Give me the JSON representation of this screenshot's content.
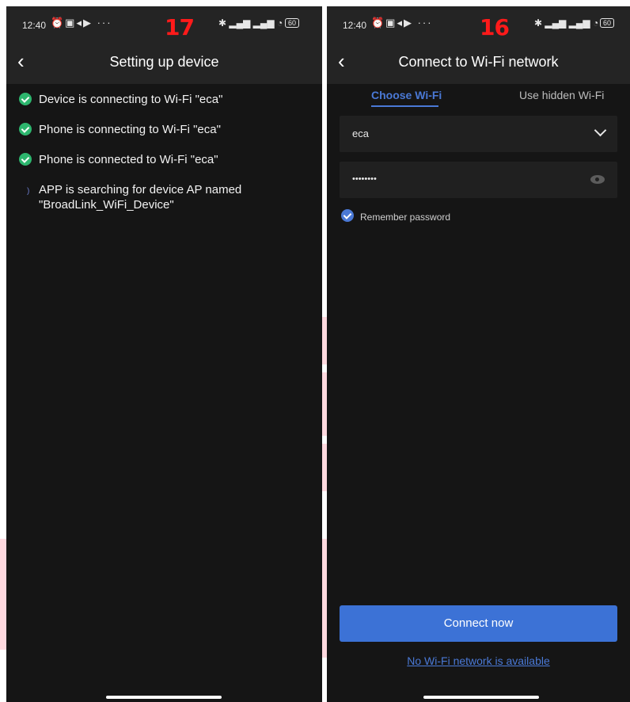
{
  "left": {
    "status": {
      "time": "12:40",
      "badge": "17",
      "battery": "60"
    },
    "header": {
      "title": "Setting up device",
      "back_icon": "chevron-left-icon"
    },
    "steps": [
      {
        "state": "done",
        "text": "Device is connecting to Wi-Fi \"eca\""
      },
      {
        "state": "done",
        "text": "Phone is connecting to Wi-Fi \"eca\""
      },
      {
        "state": "done",
        "text": "Phone is connected to Wi-Fi \"eca\""
      },
      {
        "state": "loading",
        "text": "APP is searching for device AP named \"BroadLink_WiFi_Device\""
      }
    ]
  },
  "right": {
    "status": {
      "time": "12:40",
      "badge": "16",
      "battery": "60"
    },
    "header": {
      "title": "Connect to Wi-Fi network",
      "back_icon": "chevron-left-icon"
    },
    "tabs": [
      {
        "label": "Choose Wi-Fi",
        "active": true
      },
      {
        "label": "Use hidden Wi-Fi",
        "active": false
      }
    ],
    "ssid": {
      "value": "eca"
    },
    "password": {
      "value": "••••••••"
    },
    "remember": {
      "label": "Remember password",
      "checked": true
    },
    "connect_button": "Connect now",
    "no_wifi_link": "No Wi-Fi network is available"
  },
  "colors": {
    "accent": "#4a79d6",
    "success": "#2db66e",
    "badge": "#ff1a1a",
    "background": "#151515"
  }
}
